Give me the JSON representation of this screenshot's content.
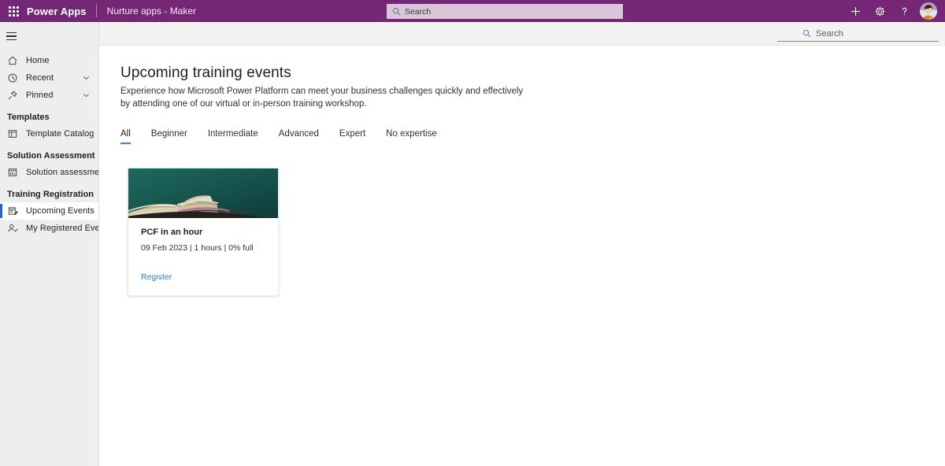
{
  "suitebar": {
    "waffle_icon": "app-launcher-icon",
    "brand": "Power Apps",
    "app_name": "Nurture apps - Maker",
    "search_placeholder": "Search",
    "search_icon": "search-icon",
    "actions": [
      {
        "name": "new-button",
        "icon": "plus-icon",
        "label": "+"
      },
      {
        "name": "settings-button",
        "icon": "gear-icon",
        "label": "Settings"
      },
      {
        "name": "help-button",
        "icon": "question-icon",
        "label": "?"
      }
    ],
    "avatar_label": "User account"
  },
  "commandbar": {
    "search_placeholder": "Search",
    "search_icon": "search-icon"
  },
  "sidebar": {
    "hamburger_label": "Collapse navigation",
    "items": [
      {
        "label": "Home",
        "icon": "home-icon",
        "chevron": false,
        "selected": false
      },
      {
        "label": "Recent",
        "icon": "clock-icon",
        "chevron": true,
        "selected": false
      },
      {
        "label": "Pinned",
        "icon": "pin-icon",
        "chevron": true,
        "selected": false
      }
    ],
    "groups": [
      {
        "title": "Templates",
        "items": [
          {
            "label": "Template Catalog",
            "icon": "template-catalog-icon",
            "selected": false
          }
        ]
      },
      {
        "title": "Solution Assessment",
        "items": [
          {
            "label": "Solution assessment",
            "icon": "solution-assessment-icon",
            "selected": false
          }
        ]
      },
      {
        "title": "Training Registration",
        "items": [
          {
            "label": "Upcoming Events",
            "icon": "upcoming-events-icon",
            "selected": true
          },
          {
            "label": "My Registered Events",
            "icon": "registered-events-icon",
            "selected": false
          }
        ]
      }
    ]
  },
  "main": {
    "title": "Upcoming training events",
    "description": "Experience how Microsoft Power Platform can meet your business challenges quickly and effectively by attending one of our virtual or in-person training workshop.",
    "tabs": [
      {
        "label": "All",
        "active": true
      },
      {
        "label": "Beginner",
        "active": false
      },
      {
        "label": "Intermediate",
        "active": false
      },
      {
        "label": "Advanced",
        "active": false
      },
      {
        "label": "Expert",
        "active": false
      },
      {
        "label": "No expertise",
        "active": false
      }
    ],
    "cards": [
      {
        "title": "PCF in an hour",
        "meta": "09 Feb 2023 | 1 hours | 0% full",
        "link_label": "Register",
        "image_alt": "open-book-on-teal-background"
      }
    ]
  },
  "colors": {
    "brand_purple": "#742774",
    "accent_blue": "#2b88d8",
    "link_blue": "#2b7cd3",
    "sidebar_bg": "#efeeee",
    "commandbar_bg": "#f3f2f1",
    "selected_indicator": "#2266cc",
    "card_image_bg": "#17564f"
  }
}
